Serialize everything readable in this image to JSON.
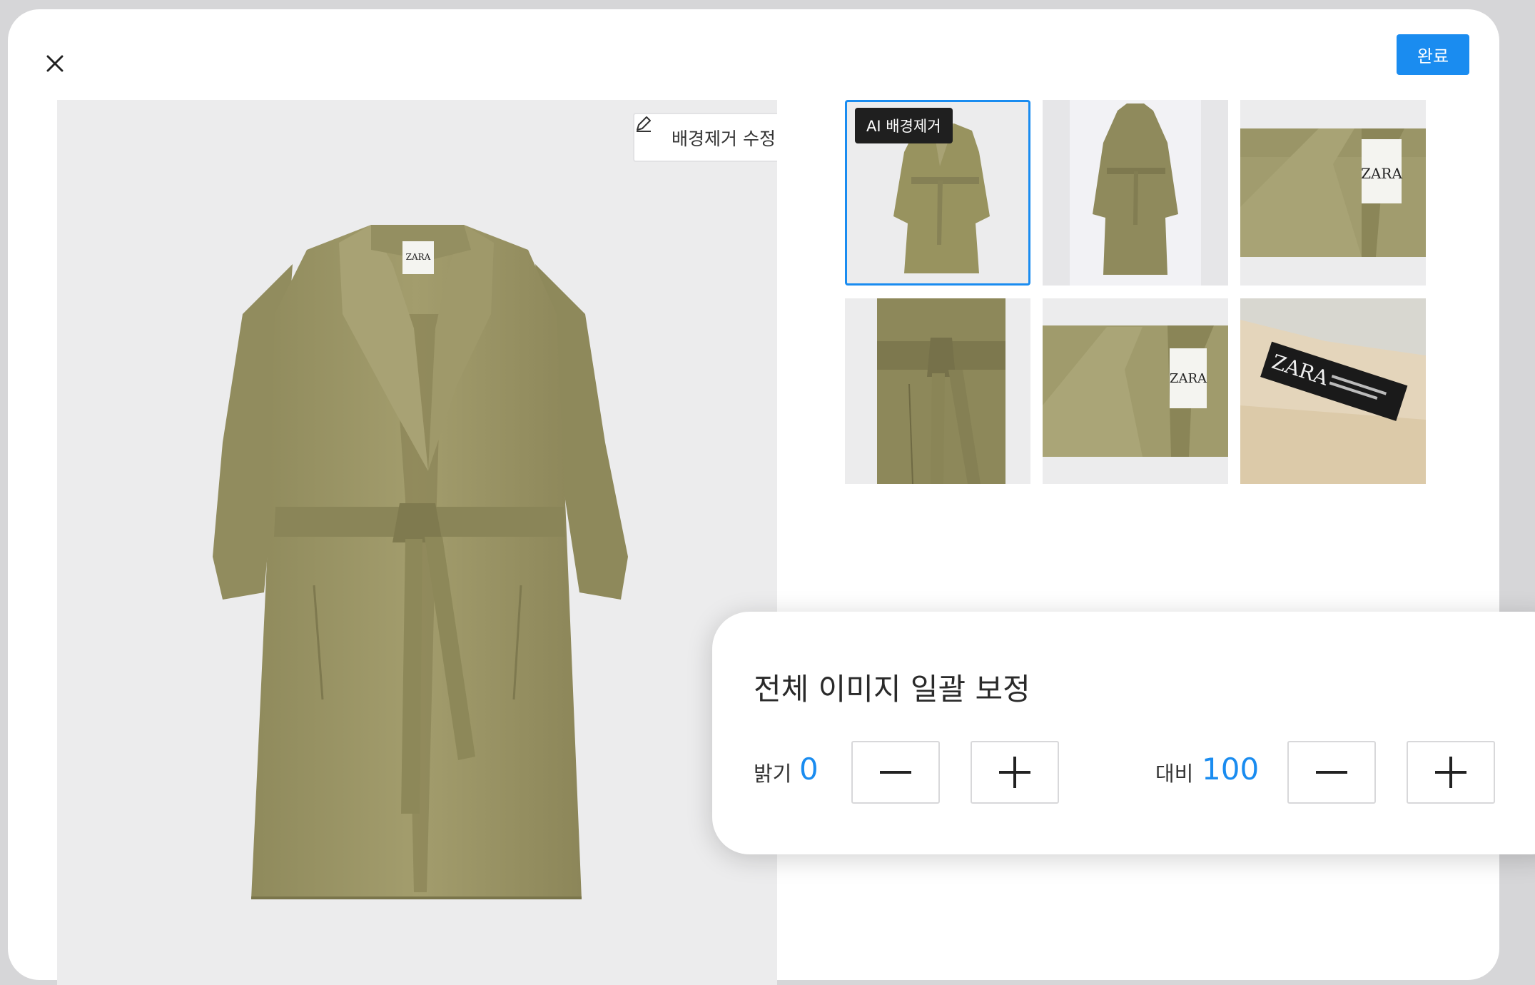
{
  "header": {
    "close_label": "X",
    "done_label": "완료",
    "accent_color": "#1a8cf0"
  },
  "preview": {
    "edit_background_label": "배경제거 수정",
    "edit_icon": "pencil-icon",
    "brand_label": "ZARA"
  },
  "thumbnails": {
    "ai_badge_label": "AI 배경제거",
    "items": [
      {
        "view": "coat-front",
        "selected": true
      },
      {
        "view": "coat-back",
        "selected": false
      },
      {
        "view": "collar-closeup",
        "selected": false
      },
      {
        "view": "belt-closeup",
        "selected": false
      },
      {
        "view": "collar-label-closeup",
        "selected": false
      },
      {
        "view": "inner-label-closeup",
        "selected": false
      }
    ]
  },
  "adjust": {
    "title": "전체 이미지 일괄 보정",
    "brightness": {
      "label": "밝기",
      "value": "0"
    },
    "contrast": {
      "label": "대비",
      "value": "100"
    },
    "minus_icon": "minus-icon",
    "plus_icon": "plus-icon"
  }
}
